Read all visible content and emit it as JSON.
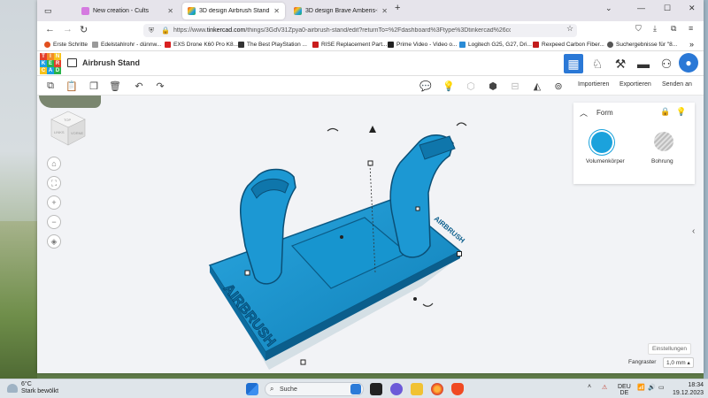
{
  "browser": {
    "tabs": [
      {
        "label": "New creation - Cults",
        "active": false
      },
      {
        "label": "3D design Airbrush Stand | Tink",
        "active": true
      },
      {
        "label": "3D design Brave Amberis-Bojo",
        "active": false
      }
    ],
    "new_tab": "+",
    "window_controls": {
      "menu": "⌄",
      "minimize": "—",
      "maximize": "☐",
      "close": "✕"
    },
    "url": {
      "prefix": "https://www.",
      "host": "tinkercad.com",
      "path": "/things/3GdV31Zpya0-airbrush-stand/edit?returnTo=%2Fdashboard%3Ftype%3Dtinkercad%26collection%3Ddes"
    },
    "bookmarks": [
      {
        "label": "Erste Schritte",
        "color": "#e2501f"
      },
      {
        "label": "Edelstahlrohr - dünnw...",
        "color": "#6b6b6b"
      },
      {
        "label": "EXS Drone K60 Pro K8...",
        "color": "#d92020"
      },
      {
        "label": "The Best PlayStation ...",
        "color": "#333333"
      },
      {
        "label": "RISE Replacement Part...",
        "color": "#c91c1c"
      },
      {
        "label": "Prime Video - Video o...",
        "color": "#222222"
      },
      {
        "label": "Logitech G25, G27, Dri...",
        "color": "#2a8bd6"
      },
      {
        "label": "Rexpeed Carbon Fiber...",
        "color": "#c21b1b"
      },
      {
        "label": "Suchergebnisse für \"8...",
        "color": "#555555"
      }
    ],
    "bookmarks_more": "»"
  },
  "app": {
    "logo_letters": [
      "T",
      "I",
      "N",
      "K",
      "E",
      "R",
      "C",
      "A",
      "D"
    ],
    "logo_colors": [
      "#e4402b",
      "#f38b26",
      "#f7c21c",
      "#1b9fe3",
      "#2ab34a",
      "#e4402b",
      "#f7c21c",
      "#1b9fe3",
      "#2ab34a"
    ],
    "design_title": "Airbrush Stand",
    "toolbar": {
      "import_label": "Importieren",
      "export_label": "Exportieren",
      "send_label": "Senden an"
    },
    "viewcube": {
      "top_face": "TOP",
      "left_face": "LINKS",
      "front_face": "VORNE"
    },
    "shape_panel": {
      "title": "Form",
      "solid_label": "Volumenkörper",
      "hole_label": "Bohrung",
      "solid_color": "#1ba2dc"
    },
    "model_text": "AIRBRUSH",
    "settings_label": "Einstellungen",
    "snap_label": "Fangraster",
    "snap_value": "1,0 mm ▴"
  },
  "taskbar": {
    "weather_temp": "6°C",
    "weather_desc": "Stark bewölkt",
    "search_label": "Suche",
    "language": "DEU",
    "region": "DE",
    "time": "18:34",
    "date": "19.12.2023"
  }
}
